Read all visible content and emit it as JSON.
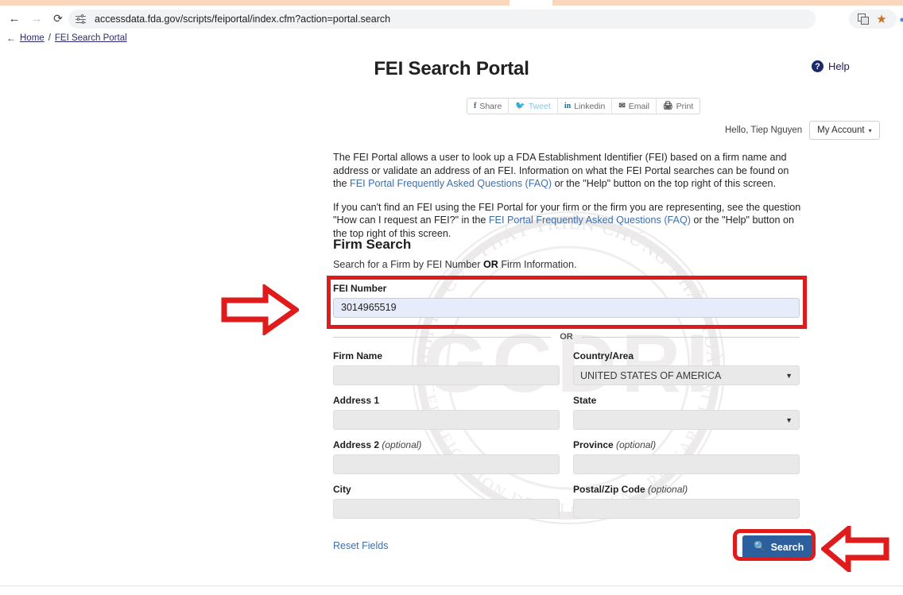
{
  "browser": {
    "url": "accessdata.fda.gov/scripts/feiportal/index.cfm?action=portal.search",
    "back_icon": "arrow-left-icon",
    "forward_icon": "arrow-right-icon",
    "reload_icon": "reload-icon",
    "site_settings_icon": "site-settings-icon",
    "translate_icon": "translate-icon",
    "bookmark_icon": "star-icon"
  },
  "breadcrumb": {
    "back_arrow": "←",
    "home": "Home",
    "separator": "/",
    "current": "FEI Search Portal"
  },
  "header": {
    "title": "FEI Search Portal",
    "help_label": "Help",
    "help_glyph": "?"
  },
  "share": {
    "items": [
      {
        "label": "Share",
        "icon": "facebook-icon",
        "glyph": "f"
      },
      {
        "label": "Tweet",
        "icon": "twitter-icon",
        "glyph": "🐦"
      },
      {
        "label": "Linkedin",
        "icon": "linkedin-icon",
        "glyph": "in"
      },
      {
        "label": "Email",
        "icon": "email-icon",
        "glyph": "✉"
      },
      {
        "label": "Print",
        "icon": "print-icon",
        "glyph": "🖨"
      }
    ]
  },
  "account": {
    "greeting": "Hello, Tiep Nguyen",
    "menu_label": "My Account",
    "caret": "▾"
  },
  "intro": {
    "p1_a": "The FEI Portal allows a user to look up a FDA Establishment Identifier (FEI) based on a firm name and address or validate an address of an FEI. Information on what the FEI Portal searches can be found on the ",
    "p1_link": "FEI Portal Frequently Asked Questions (FAQ)",
    "p1_b": " or the \"Help\" button on the top right of this screen.",
    "p2_a": "If you can't find an FEI using the FEI Portal for your firm or the firm you are representing, see the question \"How can I request an FEI?\" in the ",
    "p2_link": "FEI Portal Frequently Asked Questions (FAQ)",
    "p2_b": " or the \"Help\" button on the top right of this screen."
  },
  "firm_search": {
    "heading": "Firm Search",
    "subtext_a": "Search for a Firm by FEI Number ",
    "subtext_or": "OR",
    "subtext_b": " Firm Information.",
    "fei_label": "FEI Number",
    "fei_value": "3014965519",
    "or_divider": "OR",
    "fields": {
      "firm_name_label": "Firm Name",
      "firm_name_value": "",
      "country_label": "Country/Area",
      "country_value": "UNITED STATES OF AMERICA",
      "address1_label": "Address 1",
      "address1_value": "",
      "state_label": "State",
      "state_value": "",
      "address2_label": "Address 2",
      "address2_optional": "(optional)",
      "address2_value": "",
      "province_label": "Province",
      "province_optional": "(optional)",
      "province_value": "",
      "city_label": "City",
      "city_value": "",
      "postal_label": "Postal/Zip Code",
      "postal_optional": "(optional)",
      "postal_value": ""
    },
    "reset_label": "Reset Fields",
    "search_label": "Search",
    "search_icon": "magnifier-icon"
  },
  "annotations": {
    "fei_highlight": "red-rectangle-highlight",
    "search_highlight": "red-rounded-highlight",
    "arrow_to_fei": "red-right-arrow",
    "arrow_to_search": "red-left-arrow"
  },
  "watermark": {
    "acronym": "GCDRI",
    "outer_top": "VIỆN NGHIÊN CỨU PHÁT TRIỂN CHỨNG NHẬN TOÀN CẦU",
    "outer_bottom": "GLOBAL CERTIFICATION DEVELOPMENT RESEARCH INSTITUTE"
  },
  "colors": {
    "accent_blue": "#2c5f9e",
    "link_blue": "#3f6fa8",
    "highlight_red": "#e01b1b",
    "autofill_blue": "#e6ecf9",
    "field_gray": "#e9e9e9"
  }
}
